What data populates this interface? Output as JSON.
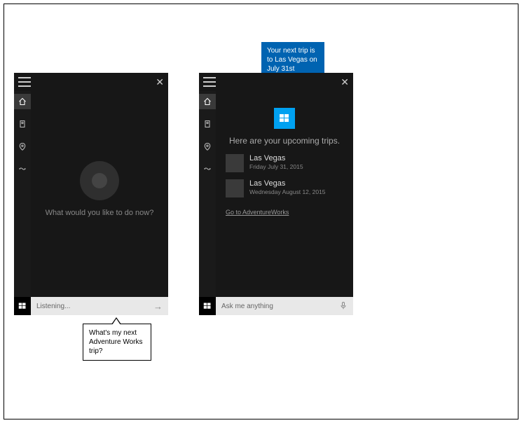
{
  "callouts": {
    "response": "Your next trip is to Las Vegas on July 31st",
    "query": "What's my next Adventure Works trip?"
  },
  "left": {
    "prompt": "What would you like to do now?",
    "search_text": "Listening...",
    "right_icon": "→"
  },
  "right": {
    "heading": "Here are your upcoming trips.",
    "trips": [
      {
        "title": "Las Vegas",
        "sub": "Friday July 31, 2015"
      },
      {
        "title": "Las Vegas",
        "sub": "Wednesday August 12, 2015"
      }
    ],
    "link": "Go to AdventureWorks",
    "search_placeholder": "Ask me anything"
  },
  "nav": {
    "items": [
      "home",
      "notebook",
      "places",
      "music"
    ]
  }
}
